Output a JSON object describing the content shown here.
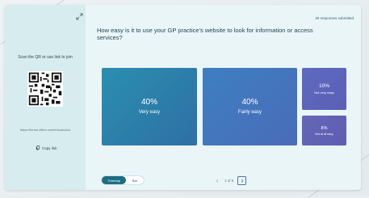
{
  "left": {
    "scan_text": "Scan the QR or use link to join",
    "url": "https://forms.office.com/e/ucandcut",
    "copy_label": "Copy link"
  },
  "main": {
    "responses": "40 responses submitted",
    "question": "How easy is it to use your GP practice's website to look for information or access services?"
  },
  "results": [
    {
      "percent": "40%",
      "label": "Very easy",
      "value": 0.4
    },
    {
      "percent": "40%",
      "label": "Fairly easy",
      "value": 0.4
    },
    {
      "percent": "10%",
      "label": "Not very easy",
      "value": 0.1
    },
    {
      "percent": "8%",
      "label": "Not at all easy",
      "value": 0.08
    }
  ],
  "controls": {
    "toggle_on": "Treemap",
    "toggle_off": "Bar",
    "page_indicator": "1 of 6"
  }
}
